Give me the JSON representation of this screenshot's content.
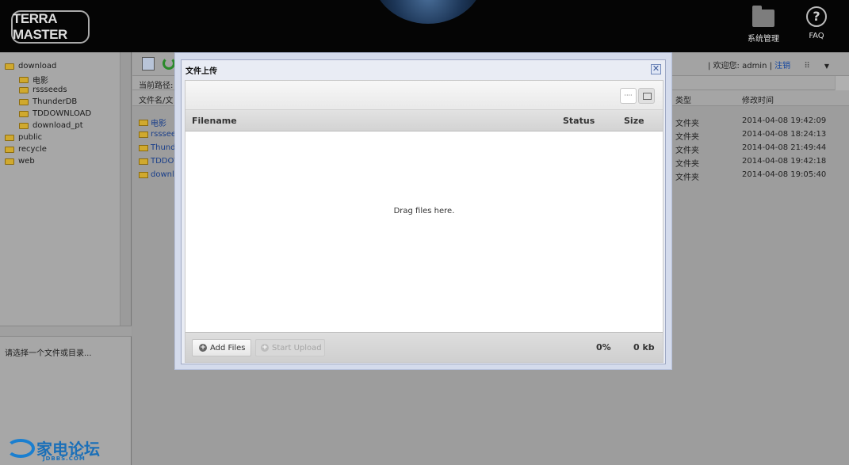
{
  "header": {
    "logo_text": "TERRA MASTER",
    "system_manage_label": "系统管理",
    "faq_label": "FAQ",
    "faq_glyph": "?"
  },
  "left_panel": {
    "tree": [
      {
        "label": "download",
        "level": 0
      },
      {
        "label": "电影",
        "level": 1
      },
      {
        "label": "rssseeds",
        "level": 1
      },
      {
        "label": "ThunderDB",
        "level": 1
      },
      {
        "label": "TDDOWNLOAD",
        "level": 1
      },
      {
        "label": "download_pt",
        "level": 1
      },
      {
        "label": "public",
        "level": 0
      },
      {
        "label": "recycle",
        "level": 0
      },
      {
        "label": "web",
        "level": 0
      }
    ],
    "info_message": "请选择一个文件或目录...",
    "brand_text": "家电论坛",
    "brand_sub": "JDBBS.COM"
  },
  "toolbar": {
    "welcome_prefix": "| 欢迎您: admin |",
    "logout_label": "注销",
    "grid_glyph": "⠿",
    "caret_glyph": "▼"
  },
  "path_bar": {
    "label": "当前路径:"
  },
  "file_table": {
    "headers": {
      "name": "文件名/文",
      "type": "类型",
      "modified": "修改时间"
    },
    "rows": [
      {
        "name": "电影",
        "type": "文件夹",
        "modified": "2014-04-08 19:42:09"
      },
      {
        "name": "rssseed",
        "type": "文件夹",
        "modified": "2014-04-08 18:24:13"
      },
      {
        "name": "Thunde",
        "type": "文件夹",
        "modified": "2014-04-08 21:49:44"
      },
      {
        "name": "TDDOV",
        "type": "文件夹",
        "modified": "2014-04-08 19:42:18"
      },
      {
        "name": "downlo",
        "type": "文件夹",
        "modified": "2014-04-08 19:05:40"
      }
    ]
  },
  "dialog": {
    "title": "文件上传",
    "close_glyph": "✕",
    "view_list_glyph": "····",
    "columns": {
      "filename": "Filename",
      "status": "Status",
      "size": "Size"
    },
    "drop_text": "Drag files here.",
    "add_files_label": "Add Files",
    "start_upload_label": "Start Upload",
    "progress_percent": "0%",
    "total_size": "0 kb"
  }
}
